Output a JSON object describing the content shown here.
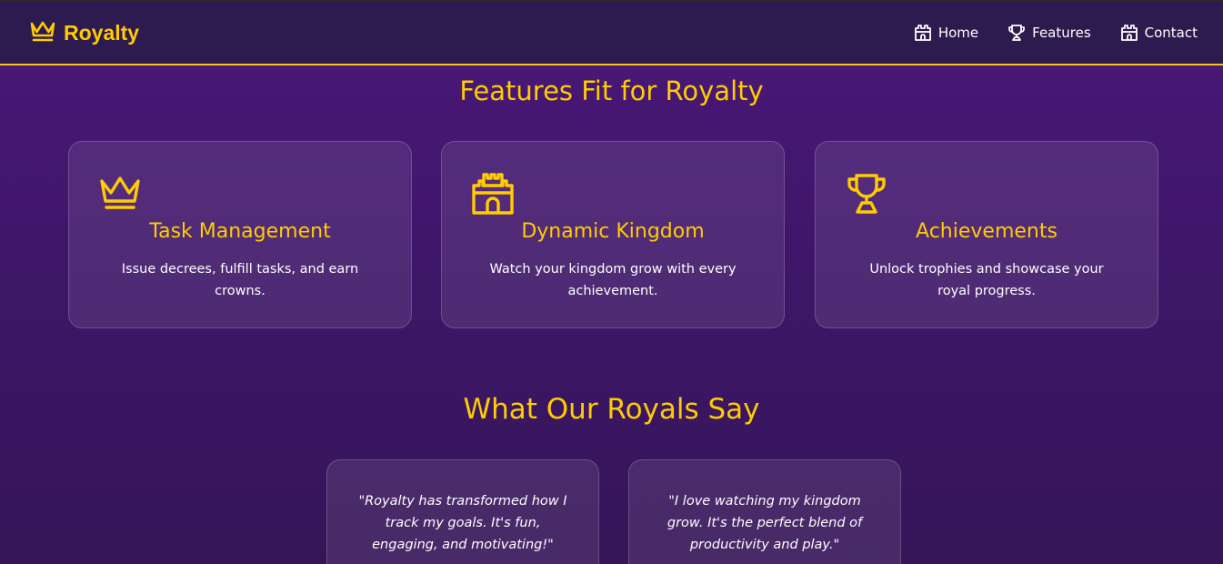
{
  "brand": {
    "name": "Royalty",
    "icon": "crown-icon",
    "color": "#ffcc00"
  },
  "nav": {
    "items": [
      {
        "label": "Home",
        "icon": "castle-icon"
      },
      {
        "label": "Features",
        "icon": "trophy-icon"
      },
      {
        "label": "Contact",
        "icon": "castle-icon"
      }
    ]
  },
  "features": {
    "title": "Features Fit for Royalty",
    "cards": [
      {
        "icon": "crown-icon",
        "title": "Task Management",
        "description": "Issue decrees, fulfill tasks, and earn crowns."
      },
      {
        "icon": "castle-icon",
        "title": "Dynamic Kingdom",
        "description": "Watch your kingdom grow with every achievement."
      },
      {
        "icon": "trophy-icon",
        "title": "Achievements",
        "description": "Unlock trophies and showcase your royal progress."
      }
    ]
  },
  "testimonials": {
    "title": "What Our Royals Say",
    "items": [
      {
        "quote": "\"Royalty has transformed how I track my goals. It's fun, engaging, and motivating!\""
      },
      {
        "quote": "\"I love watching my kingdom grow. It's the perfect blend of productivity and play.\""
      }
    ]
  },
  "colors": {
    "accent": "#ffcc00",
    "navbar_bg": "#2d1a4e",
    "page_bg": "#4a1878"
  }
}
